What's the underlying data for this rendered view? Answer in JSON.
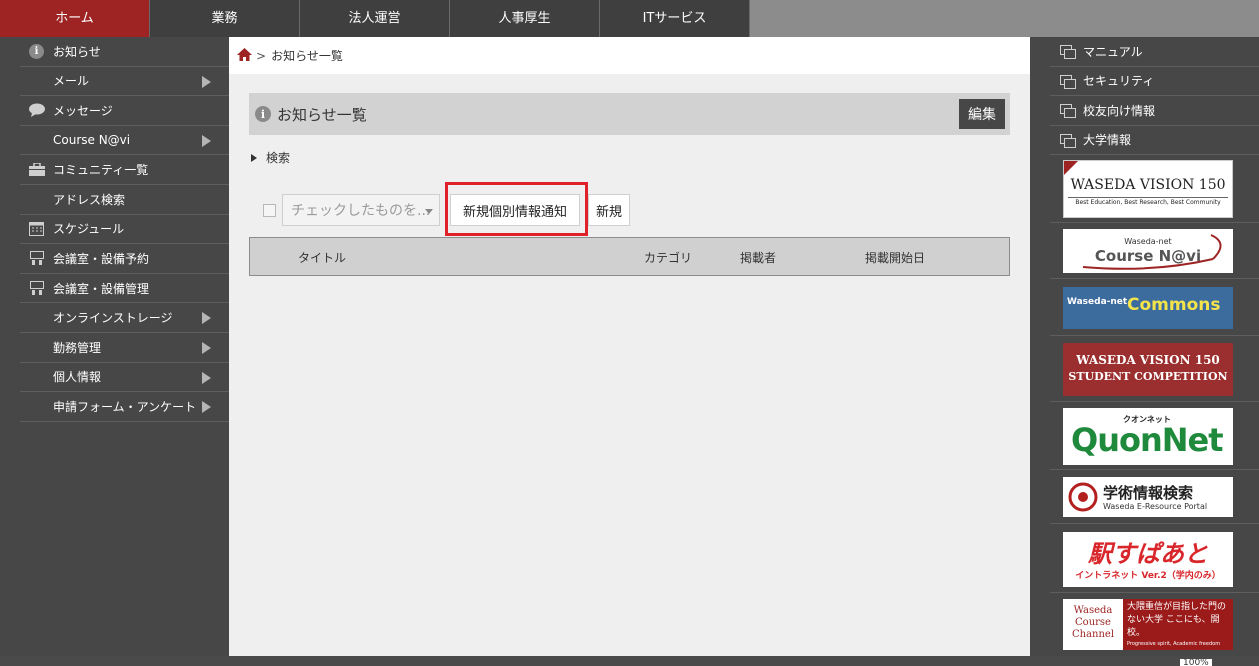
{
  "topnav": {
    "tabs": [
      {
        "label": "ホーム",
        "active": true
      },
      {
        "label": "業務"
      },
      {
        "label": "法人運営"
      },
      {
        "label": "人事厚生"
      },
      {
        "label": "ITサービス"
      }
    ]
  },
  "leftnav": {
    "items": [
      {
        "label": "お知らせ",
        "icon": "info-icon",
        "submenu": false
      },
      {
        "label": "メール",
        "icon": "",
        "submenu": true
      },
      {
        "label": "メッセージ",
        "icon": "speech-bubble-icon",
        "submenu": false
      },
      {
        "label": "Course N@vi",
        "icon": "",
        "submenu": true
      },
      {
        "label": "コミュニティ一覧",
        "icon": "briefcase-icon",
        "submenu": false
      },
      {
        "label": "アドレス検索",
        "icon": "",
        "submenu": false
      },
      {
        "label": "スケジュール",
        "icon": "calendar-icon",
        "submenu": false
      },
      {
        "label": "会議室・設備予約",
        "icon": "facility-icon",
        "submenu": false
      },
      {
        "label": "会議室・設備管理",
        "icon": "facility-icon",
        "submenu": false
      },
      {
        "label": "オンラインストレージ",
        "icon": "",
        "submenu": true
      },
      {
        "label": "勤務管理",
        "icon": "",
        "submenu": true
      },
      {
        "label": "個人情報",
        "icon": "",
        "submenu": true
      },
      {
        "label": "申請フォーム・アンケート",
        "icon": "",
        "submenu": true
      }
    ]
  },
  "main": {
    "breadcrumb": {
      "sep": ">",
      "current": "お知らせ一覧"
    },
    "panel_title": "お知らせ一覧",
    "edit_label": "編集",
    "search_label": "検索",
    "bulk_select_placeholder": "チェックしたものを...",
    "notify_button": "新規個別情報通知",
    "new_button": "新規",
    "table_headers": {
      "title": "タイトル",
      "category": "カテゴリ",
      "poster": "掲載者",
      "start_date": "掲載開始日"
    }
  },
  "rightnav": {
    "links": [
      "マニュアル",
      "セキュリティ",
      "校友向け情報",
      "大学情報"
    ],
    "banners": {
      "b1_title": "WASEDA VISION 150",
      "b1_sub": "Best Education, Best Research, Best Community",
      "b2_top": "Waseda-net",
      "b2_main": "Course N@vi",
      "b3_top": "Waseda-net",
      "b3_main": "Commons",
      "b4_line1": "WASEDA VISION 150",
      "b4_line2": "STUDENT COMPETITION",
      "b5_top": "クオンネット",
      "b5_main": "QuonNet",
      "b6_main": "学術情報検索",
      "b6_sub": "Waseda E-Resource Portal",
      "b7_main": "駅すぱあと",
      "b7_sub": "イントラネット Ver.2（学内のみ）",
      "b8_left": "Waseda Course Channel",
      "b8_right": "大隈重信が目指した門のない大学 ここにも、開校。",
      "b8_sub": "Progressive spirit, Academic freedom"
    }
  },
  "status": {
    "zoom": "100%"
  },
  "colors": {
    "accent": "#9e2424",
    "highlight": "#e0202a"
  }
}
